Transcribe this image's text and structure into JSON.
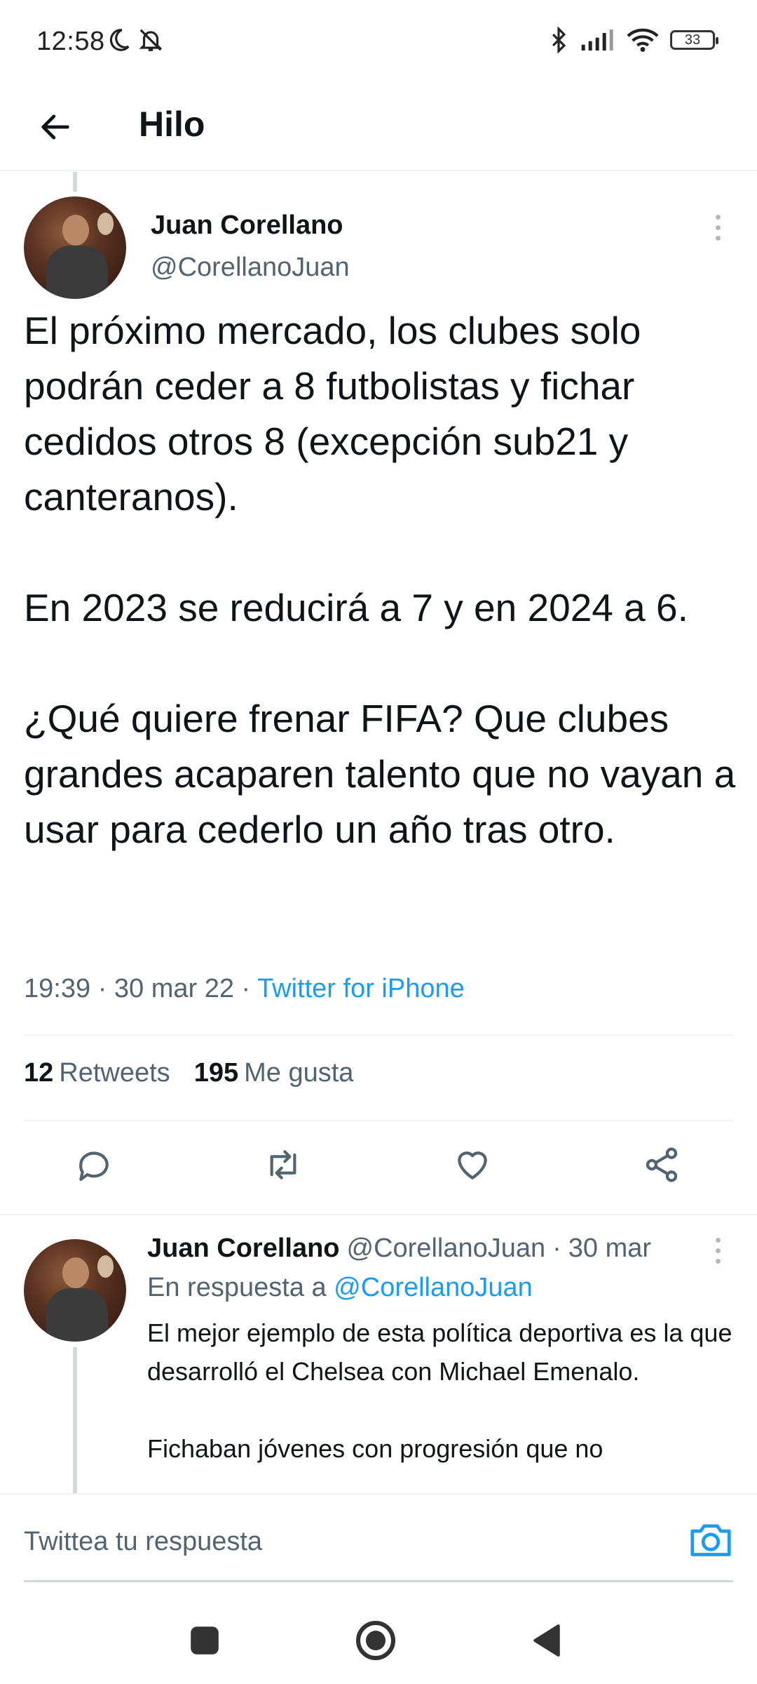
{
  "status_bar": {
    "time": "12:58",
    "battery": "33",
    "icons": [
      "moon-icon",
      "notifications-off-icon",
      "bluetooth-icon",
      "signal-icon",
      "wifi-icon",
      "battery-icon"
    ]
  },
  "header": {
    "title": "Hilo",
    "back_icon": "arrow-left-icon"
  },
  "main_tweet": {
    "author_name": "Juan Corellano",
    "author_handle": "@CorellanoJuan",
    "text": "El próximo mercado, los clubes solo podrán ceder a 8 futbolistas y fichar cedidos otros 8 (excepción sub21 y canteranos).\n\nEn 2023 se reducirá a 7 y en 2024 a 6.\n\n¿Qué quiere frenar FIFA? Que clubes grandes acaparen talento que no vayan a usar para cederlo un año tras otro.",
    "time": "19:39",
    "separator": "·",
    "date": "30 mar 22",
    "source": "Twitter for iPhone",
    "retweets_count": "12",
    "retweets_label": "Retweets",
    "likes_count": "195",
    "likes_label": "Me gusta"
  },
  "actions": {
    "icons": [
      "reply-icon",
      "retweet-icon",
      "like-icon",
      "share-icon"
    ]
  },
  "reply_tweet": {
    "author_name": "Juan Corellano",
    "author_handle": "@CorellanoJuan",
    "separator": "·",
    "date": "30 mar",
    "reply_to_label": "En respuesta a",
    "reply_to_handle": "@CorellanoJuan",
    "text": "El mejor ejemplo de esta política deportiva es la que desarrolló el Chelsea con Michael Emenalo.\n\nFichaban jóvenes con progresión que no"
  },
  "compose": {
    "placeholder": "Twittea tu respuesta",
    "camera_icon": "camera-icon"
  },
  "nav_bar": {
    "icons": [
      "recents-square-icon",
      "home-circle-icon",
      "back-triangle-icon"
    ]
  },
  "colors": {
    "accent": "#1d9bf0",
    "secondary_text": "#536471",
    "primary_text": "#0f1419",
    "divider": "#eff3f4"
  }
}
